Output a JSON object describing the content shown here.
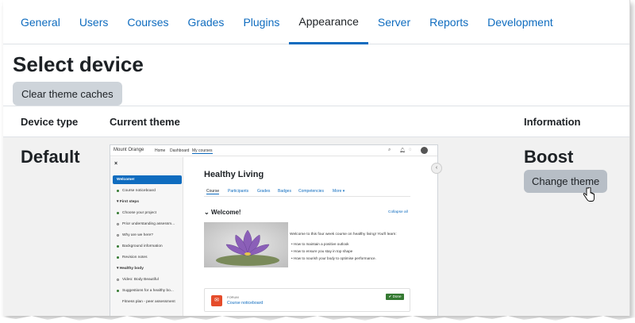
{
  "tabs": [
    {
      "label": "General"
    },
    {
      "label": "Users"
    },
    {
      "label": "Courses"
    },
    {
      "label": "Grades"
    },
    {
      "label": "Plugins"
    },
    {
      "label": "Appearance",
      "active": true
    },
    {
      "label": "Server"
    },
    {
      "label": "Reports"
    },
    {
      "label": "Development"
    }
  ],
  "page": {
    "title": "Select device",
    "clear_caches_label": "Clear theme caches"
  },
  "table": {
    "headers": {
      "device_type": "Device type",
      "current_theme": "Current theme",
      "information": "Information"
    },
    "row": {
      "device": "Default",
      "theme_name": "Boost",
      "change_theme_label": "Change theme"
    }
  },
  "preview": {
    "brand": "Mount Orange",
    "nav": [
      "Home",
      "Dashboard",
      "My courses"
    ],
    "sidebar": {
      "close": "×",
      "items": [
        {
          "label": "Welcome!",
          "kind": "selected"
        },
        {
          "label": "Course noticeboard",
          "kind": "green"
        },
        {
          "label": "First steps",
          "kind": "section"
        },
        {
          "label": "Choose your project",
          "kind": "green"
        },
        {
          "label": "Prior understanding assessm...",
          "kind": "open"
        },
        {
          "label": "Why are we here?",
          "kind": "open"
        },
        {
          "label": "Background information",
          "kind": "green"
        },
        {
          "label": "Revision notes",
          "kind": "green"
        },
        {
          "label": "Healthy body",
          "kind": "section"
        },
        {
          "label": "Video: Body Beautiful",
          "kind": "open"
        },
        {
          "label": "Suggestions for a healthy bo...",
          "kind": "green"
        },
        {
          "label": "Fitness plan - peer assessment",
          "kind": "none"
        }
      ]
    },
    "course_title": "Healthy Living",
    "course_tabs": [
      "Course",
      "Participants",
      "Grades",
      "Badges",
      "Competencies",
      "More ▾"
    ],
    "section_title": "Welcome!",
    "collapse_all": "Collapse all",
    "description": "Welcome to this four week course on healthy living! You'll learn:",
    "bullets": [
      "How to maintain a positive outlook",
      "How to ensure you stay in top shape",
      "How to nourish your body to optimise performance."
    ],
    "forum": {
      "type_label": "FORUM",
      "name": "Course noticeboard",
      "status": "✔ Done"
    }
  },
  "icons": [
    "search-icon",
    "bell-icon",
    "chat-icon",
    "avatar",
    "chevron-left-icon",
    "hand-cursor-icon"
  ]
}
